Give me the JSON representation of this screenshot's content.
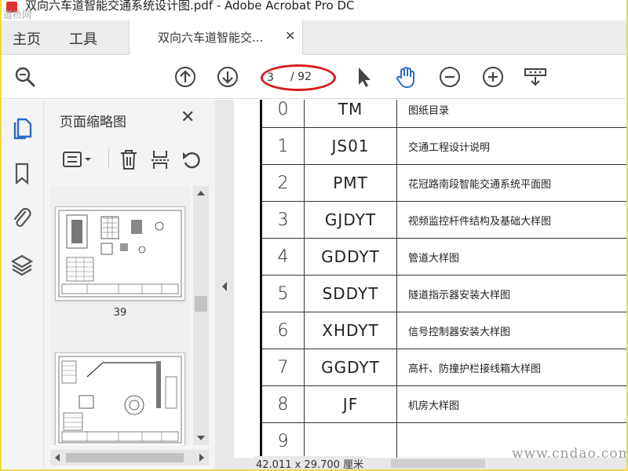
{
  "window": {
    "title": "双向六车道智能交通系统设计图.pdf - Adobe Acrobat Pro DC",
    "watermark_logo": "道桥网"
  },
  "tabs": {
    "home": "主页",
    "tools": "工具",
    "document": "双向六车道智能交..."
  },
  "toolbar": {
    "current_page": "3",
    "total_pages": "/ 92",
    "icons": [
      "search-icon",
      "prev-page-icon",
      "next-page-icon",
      "select-cursor-icon",
      "hand-icon",
      "zoom-out-icon",
      "zoom-in-icon",
      "read-mode-icon"
    ]
  },
  "thumbnail_panel": {
    "title": "页面缩略图",
    "thumbnails": [
      {
        "page": "39"
      },
      {
        "page": ""
      }
    ]
  },
  "document": {
    "rows": [
      {
        "no": "0",
        "code": "TM",
        "name": "图纸目录"
      },
      {
        "no": "1",
        "code": "JS01",
        "name": "交通工程设计说明"
      },
      {
        "no": "2",
        "code": "PMT",
        "name": "花冠路南段智能交通系统平面图"
      },
      {
        "no": "3",
        "code": "GJDYT",
        "name": "视频监控杆件结构及基础大样图"
      },
      {
        "no": "4",
        "code": "GDDYT",
        "name": "管道大样图"
      },
      {
        "no": "5",
        "code": "SDDYT",
        "name": "隧道指示器安装大样图"
      },
      {
        "no": "6",
        "code": "XHDYT",
        "name": "信号控制器安装大样图"
      },
      {
        "no": "7",
        "code": "GGDYT",
        "name": "高杆、防撞护栏接线箱大样图"
      },
      {
        "no": "8",
        "code": "JF",
        "name": "机房大样图"
      },
      {
        "no": "9",
        "code": "",
        "name": ""
      }
    ],
    "page_size": "42.011 x 29.700 厘米"
  },
  "watermark": "www.cndao.com",
  "colors": {
    "frame_yellow": "#f2d84a",
    "annotation_red": "#d51f1f",
    "icon_blue": "#2b6cc4"
  }
}
